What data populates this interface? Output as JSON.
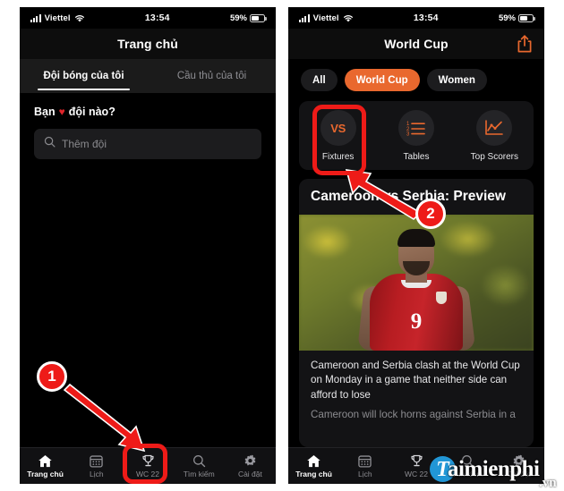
{
  "status_bar": {
    "carrier": "Viettel",
    "time": "13:54",
    "battery_pct": "59%",
    "signal_icon": "signal-bars-icon",
    "wifi_icon": "wifi-icon",
    "battery_icon": "battery-icon"
  },
  "left_phone": {
    "nav_title": "Trang chủ",
    "tabs": [
      {
        "label": "Đội bóng của tôi",
        "active": true
      },
      {
        "label": "Cầu thủ của tôi",
        "active": false
      }
    ],
    "favourites_prompt_before": "Bạn",
    "favourites_heart": "♥",
    "favourites_prompt_after": "đội nào?",
    "search_placeholder": "Thêm đội",
    "search_icon": "search-icon"
  },
  "right_phone": {
    "nav_title": "World Cup",
    "share_icon": "share-icon",
    "chips": [
      {
        "label": "All",
        "active": false
      },
      {
        "label": "World Cup",
        "active": true
      },
      {
        "label": "Women",
        "active": false
      }
    ],
    "quick_actions": [
      {
        "label": "Fixtures",
        "icon": "vs-icon",
        "icon_text": "VS"
      },
      {
        "label": "Tables",
        "icon": "numbered-list-icon",
        "icon_text": ""
      },
      {
        "label": "Top Scorers",
        "icon": "line-chart-icon",
        "icon_text": ""
      }
    ],
    "article": {
      "headline": "Cameroon vs Serbia: Preview",
      "photo_alt": "serbia-player-photo",
      "jersey_number": "9",
      "summary": "Cameroon and Serbia clash at the World Cup on Monday in a game that neither side can afford to lose",
      "summary_cut": "Cameroon will lock horns against Serbia in a"
    }
  },
  "tab_bar": [
    {
      "label": "Trang chủ",
      "icon": "home-icon",
      "active": true
    },
    {
      "label": "Lịch",
      "icon": "calendar-icon",
      "active": false
    },
    {
      "label": "WC 22",
      "icon": "trophy-icon",
      "active": false
    },
    {
      "label": "Tìm kiếm",
      "icon": "search-icon",
      "active": false
    },
    {
      "label": "Cài đặt",
      "icon": "gear-icon",
      "active": false
    }
  ],
  "annotations": [
    {
      "number": "1",
      "target": "wc22-tab",
      "color": "#ee1b18"
    },
    {
      "number": "2",
      "target": "fixtures-button",
      "color": "#ee1b18"
    }
  ],
  "watermark": {
    "logo_letter": "T",
    "name": "aimienphi",
    "tld": ".vn"
  },
  "colors": {
    "accent_orange": "#e9682e",
    "annotation_red": "#ee1b18",
    "heart_red": "#e0252b",
    "background": "#000000",
    "card": "#131315",
    "watermark_blue": "#2196d6"
  }
}
